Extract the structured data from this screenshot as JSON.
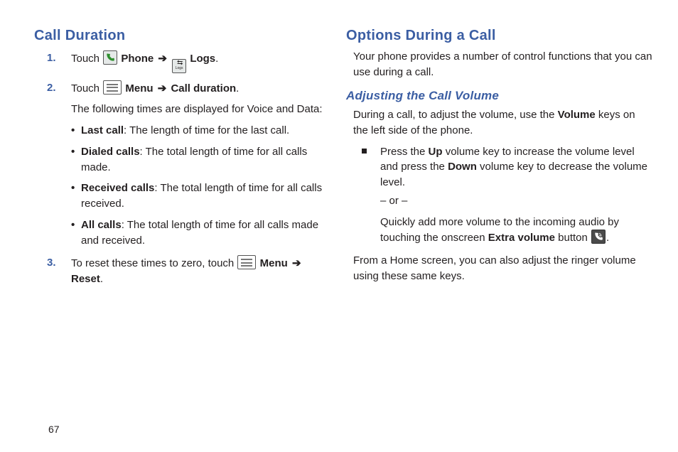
{
  "page_number": "67",
  "left": {
    "heading": "Call Duration",
    "step1": {
      "num": "1.",
      "a": "Touch ",
      "phone": "Phone",
      "logs": "Logs",
      "dot": "."
    },
    "step2": {
      "num": "2.",
      "a": "Touch ",
      "menu": "Menu",
      "cd": "Call duration",
      "dot": ".",
      "intro": "The following times are displayed for Voice and Data:"
    },
    "bullets": {
      "b1l": "Last call",
      "b1r": ": The length of time for the last call.",
      "b2l": "Dialed calls",
      "b2r": ": The total length of time for all calls made.",
      "b3l": "Received calls",
      "b3r": ": The total length of time for all calls received.",
      "b4l": "All calls",
      "b4r": ": The total length of time for all calls made and received."
    },
    "step3": {
      "num": "3.",
      "a": "To reset these times to zero, touch ",
      "menu": "Menu",
      "reset": "Reset",
      "dot": "."
    }
  },
  "right": {
    "heading": "Options During a Call",
    "intro": "Your phone provides a number of control functions that you can use during a call.",
    "sub": "Adjusting the Call Volume",
    "p1a": "During a call, to adjust the volume, use the ",
    "p1b": "Volume",
    "p1c": " keys on the left side of the phone.",
    "sq": {
      "a": "Press the ",
      "up": "Up",
      "b": " volume key to increase the volume level and press the ",
      "down": "Down",
      "c": " volume key to decrease the volume level.",
      "or": "– or –",
      "d": "Quickly add more volume to the incoming audio by touching the onscreen ",
      "extra": "Extra volume",
      "e": " button ",
      "dot": "."
    },
    "outro": "From a Home screen, you can also adjust the ringer volume using these same keys."
  },
  "icons": {
    "arrow": "➔"
  }
}
